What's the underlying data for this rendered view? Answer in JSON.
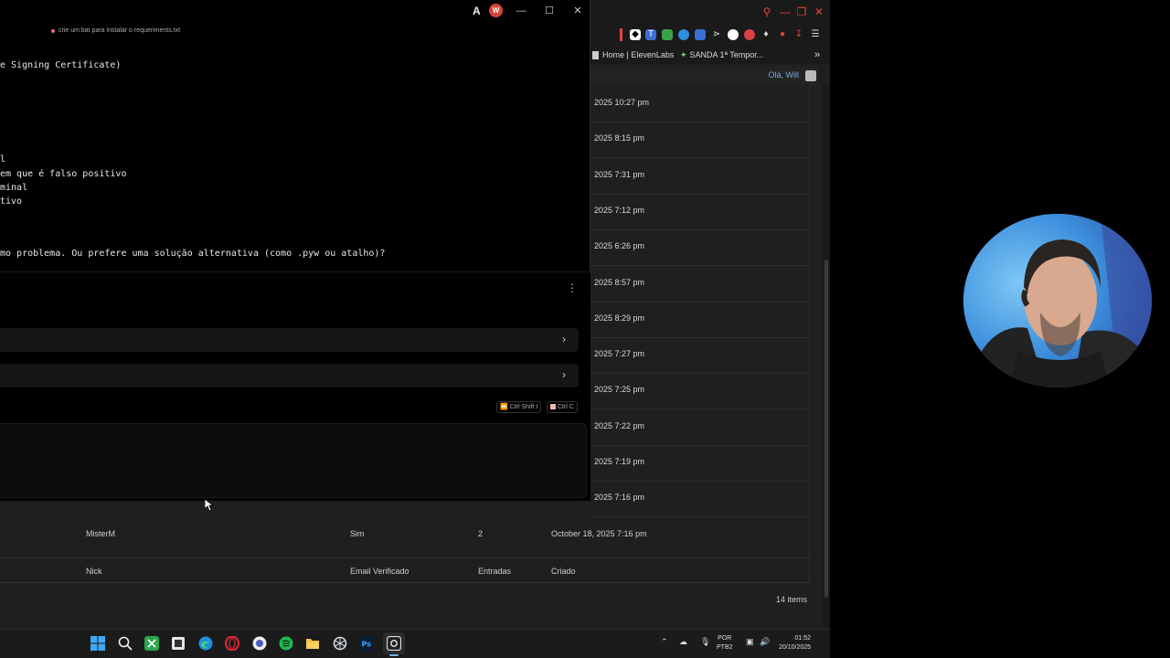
{
  "terminal": {
    "tab_title": "crie um bat para instalar o requeriments.txt",
    "user_initial": "W",
    "app_icon_glyph": "A",
    "lines": [
      "e Signing Certificate)",
      "l",
      "em que é falso positivo",
      "minal",
      "tivo",
      "mo problema. Ou prefere uma solução alternativa (como .pyw ou atalho)?"
    ],
    "shortcuts": [
      "Ctrl Shift I",
      "Ctrl C"
    ],
    "accent": "#d9433a"
  },
  "browser": {
    "bookmarks": [
      "Home | ElevenLabs",
      "SANDA 1ª Tempor..."
    ],
    "greeting": "Olá, Will",
    "dates": [
      "2025 10:27 pm",
      "2025 8:15 pm",
      "2025 7:31 pm",
      "2025 7:12 pm",
      "2025 6:26 pm",
      "2025 8:57 pm",
      "2025 8:29 pm",
      "2025 7:27 pm",
      "2025 7:25 pm",
      "2025 7:22 pm",
      "2025 7:19 pm",
      "2025 7:16 pm"
    ],
    "last_row": {
      "nick": "MisterM",
      "verified": "Sim",
      "entries": "2",
      "created": "October 18, 2025 7:16 pm"
    },
    "columns": {
      "nick": "Nick",
      "verified": "Email Verificado",
      "entries": "Entradas",
      "created": "Criado"
    },
    "items_count": "14 items"
  },
  "taskbar": {
    "lang": "POR",
    "layout": "PTB2",
    "time": "01:52",
    "date": "20/10/2025",
    "icons": [
      "windows-start-icon",
      "search-icon",
      "xbox-icon",
      "app-icon",
      "edge-icon",
      "opera-icon",
      "app-icon",
      "spotify-icon",
      "file-explorer-icon",
      "chatgpt-icon",
      "photoshop-icon",
      "terminal-icon"
    ]
  }
}
